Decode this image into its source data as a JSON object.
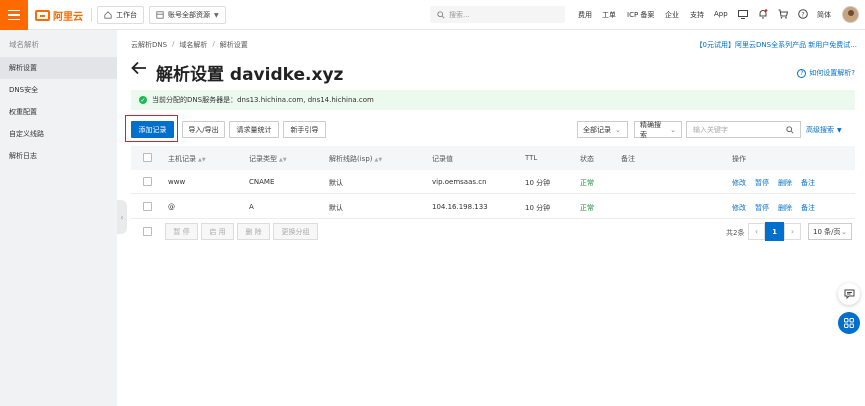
{
  "brand": {
    "logo_text": "阿里云",
    "accent_color": "#ff6a00"
  },
  "topbar": {
    "workbench_label": "工作台",
    "resources_label": "账号全部资源",
    "search_placeholder": "搜索...",
    "nav": [
      "费用",
      "工单",
      "ICP 备案",
      "企业",
      "支持",
      "App"
    ],
    "lang_label": "简体",
    "icons": [
      "screen-icon",
      "bell-icon",
      "cart-icon",
      "help-icon"
    ]
  },
  "sidebar": {
    "title": "域名解析",
    "items": [
      {
        "label": "解析设置",
        "active": true
      },
      {
        "label": "DNS安全",
        "active": false
      },
      {
        "label": "权重配置",
        "active": false
      },
      {
        "label": "自定义线路",
        "active": false
      },
      {
        "label": "解析日志",
        "active": false
      }
    ]
  },
  "breadcrumb": [
    "云解析DNS",
    "域名解析",
    "解析设置"
  ],
  "promo": "【0元试用】阿里云DNS全系列产品 新用户免费试...",
  "page": {
    "title": "解析设置 davidke.xyz",
    "help_link": "如何设置解析?"
  },
  "dns_notice": "当前分配的DNS服务器是：dns13.hichina.com, dns14.hichina.com",
  "toolbar": {
    "add_record": "添加记录",
    "import_export": "导入/导出",
    "request_stats": "请求量统计",
    "guide": "新手引导",
    "all_records": "全部记录",
    "exact_search": "精确搜索",
    "keyword_placeholder": "输入关键字",
    "advanced_search": "高级搜索"
  },
  "table": {
    "columns": [
      "主机记录",
      "记录类型",
      "解析线路(isp)",
      "记录值",
      "TTL",
      "状态",
      "备注",
      "操作"
    ],
    "rows": [
      {
        "host": "www",
        "type": "CNAME",
        "line": "默认",
        "value": "vip.oemsaas.cn",
        "ttl": "10 分钟",
        "status": "正常",
        "remark": ""
      },
      {
        "host": "@",
        "type": "A",
        "line": "默认",
        "value": "104.16.198.133",
        "ttl": "10 分钟",
        "status": "正常",
        "remark": ""
      }
    ],
    "actions": [
      "修改",
      "暂停",
      "删除",
      "备注"
    ]
  },
  "bulk": [
    "暂 停",
    "启 用",
    "删 除",
    "更换分组"
  ],
  "pagination": {
    "total": "共2条",
    "current": "1",
    "page_size": "10 条/页"
  }
}
